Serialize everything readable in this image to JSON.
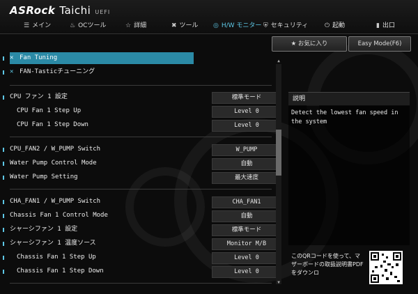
{
  "header": {
    "brand": "ASRock",
    "model": "Taichi",
    "uefi": "UEFI"
  },
  "nav": {
    "tabs": [
      {
        "label": "メイン",
        "icon": "list-icon"
      },
      {
        "label": "OCツール",
        "icon": "flame-icon"
      },
      {
        "label": "詳細",
        "icon": "star-icon"
      },
      {
        "label": "ツール",
        "icon": "tools-icon"
      },
      {
        "label": "H/W モニター",
        "icon": "monitor-icon",
        "active": true
      },
      {
        "label": "セキュリティ",
        "icon": "shield-icon"
      },
      {
        "label": "起動",
        "icon": "power-icon"
      },
      {
        "label": "出口",
        "icon": "exit-icon"
      }
    ]
  },
  "menu": {
    "fan_tuning": "Fan Tuning",
    "fan_tastic": "FAN-Tasticチューニング"
  },
  "settings": [
    {
      "label": "CPU ファン 1 設定",
      "value": "標準モード"
    },
    {
      "label": "CPU Fan 1 Step Up",
      "value": "Level 0"
    },
    {
      "label": "CPU Fan 1 Step Down",
      "value": "Level 0"
    },
    {
      "label": "CPU_FAN2 / W_PUMP Switch",
      "value": "W_PUMP"
    },
    {
      "label": "Water Pump Control Mode",
      "value": "自動"
    },
    {
      "label": "Water Pump Setting",
      "value": "最大速度"
    },
    {
      "label": "CHA_FAN1 / W_PUMP Switch",
      "value": "CHA_FAN1"
    },
    {
      "label": "Chassis Fan 1 Control Mode",
      "value": "自動"
    },
    {
      "label": "シャーシファン 1 設定",
      "value": "標準モード"
    },
    {
      "label": "シャーシファン 1 温度ソース",
      "value": "Monitor M/B"
    },
    {
      "label": "Chassis Fan 1 Step Up",
      "value": "Level 0"
    },
    {
      "label": "Chassis Fan 1 Step Down",
      "value": "Level 0"
    }
  ],
  "right": {
    "favorites": "お気に入り",
    "easy_mode": "Easy Mode(F6)",
    "desc_title": "説明",
    "desc_text": "Detect the lowest fan speed in the system",
    "qr_text": "このQRコードを使って、マザーボードの取扱説明書PDFをダウンロ"
  }
}
